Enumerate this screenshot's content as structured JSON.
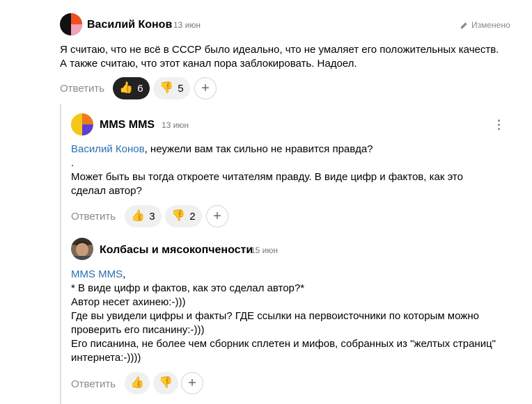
{
  "comments": [
    {
      "author": "Василий Конов",
      "date": "13 июн",
      "edited_label": "Изменено",
      "text_lines": [
        "Я считаю, что не всё в СССР было идеально, что не умаляет его положительных качеств.",
        "А также считаю, что этот канал пора заблокировать. Надоел."
      ],
      "reply_label": "Ответить",
      "likes": "6",
      "dislikes": "5"
    },
    {
      "author": "MMS MMS",
      "date": "13 июн",
      "mention": "Василий Конов",
      "first_line_rest": ", неужели вам так сильно не нравится правда?",
      "text_lines": [
        ".",
        "Может быть вы тогда откроете читателям правду. В виде цифр и фактов, как это",
        "сделал автор?"
      ],
      "reply_label": "Ответить",
      "likes": "3",
      "dislikes": "2"
    },
    {
      "author": "Колбасы и мясокопчености",
      "date": "15 июн",
      "mention": "MMS MMS",
      "mention_suffix": ",",
      "text_lines": [
        "* В виде цифр и фактов, как это сделал автор?*",
        "Автор несет ахинею:-)))",
        "Где вы увидели цифры и факты? ГДЕ ссылки на первоисточники по которым можно",
        "проверить его писанину:-)))",
        "Его писанина, не более чем сборник сплетен и мифов, собранных из \"желтых страниц\"",
        "интернета:-))))"
      ],
      "reply_label": "Ответить"
    }
  ],
  "icons": {
    "like": "thumbs-up-icon",
    "dislike": "thumbs-down-icon",
    "add_reaction": "plus-icon",
    "edit": "pencil-icon",
    "menu": "kebab-menu-icon"
  },
  "colors": {
    "mention": "#2a6fb0",
    "active_pill": "#222222",
    "pill": "#f0f0f0"
  }
}
